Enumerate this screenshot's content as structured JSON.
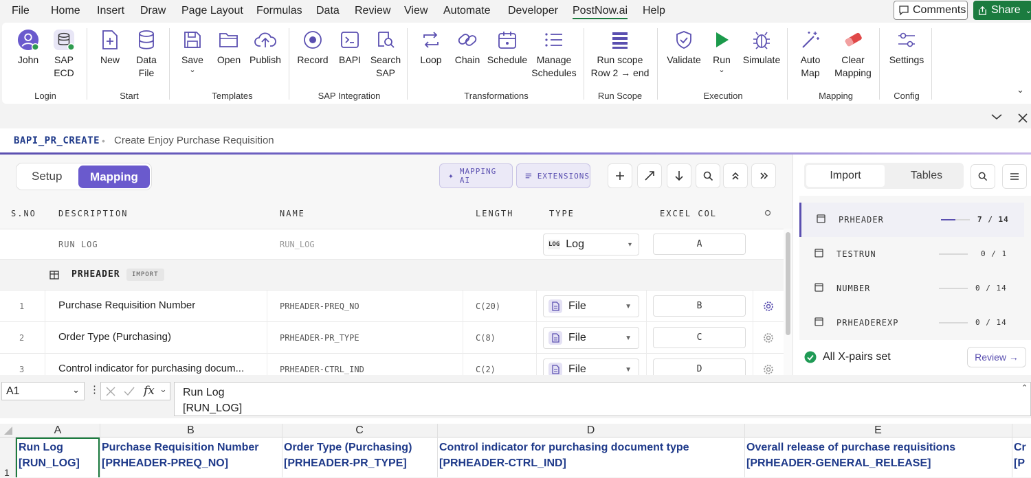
{
  "menu": {
    "items": [
      "File",
      "Home",
      "Insert",
      "Draw",
      "Page Layout",
      "Formulas",
      "Data",
      "Review",
      "View",
      "Automate",
      "Developer",
      "PostNow.ai",
      "Help"
    ],
    "active": "PostNow.ai",
    "comments_label": "Comments",
    "share_label": "Share"
  },
  "ribbon": {
    "buttons": {
      "john": "John",
      "sap_ecd_1": "SAP",
      "sap_ecd_2": "ECD",
      "new": "New",
      "data_file_1": "Data",
      "data_file_2": "File",
      "save": "Save",
      "open": "Open",
      "publish": "Publish",
      "record": "Record",
      "bapi": "BAPI",
      "search_sap_1": "Search",
      "search_sap_2": "SAP",
      "loop": "Loop",
      "chain": "Chain",
      "schedule": "Schedule",
      "manage_1": "Manage",
      "manage_2": "Schedules",
      "run_scope_1": "Run scope",
      "run_scope_2": "Row 2 → end",
      "validate": "Validate",
      "run": "Run",
      "simulate": "Simulate",
      "auto_map_1": "Auto",
      "auto_map_2": "Map",
      "clear_map_1": "Clear",
      "clear_map_2": "Mapping",
      "settings": "Settings"
    },
    "groups": {
      "login": "Login",
      "start": "Start",
      "templates": "Templates",
      "sap_integration": "SAP Integration",
      "transformations": "Transformations",
      "run_scope": "Run Scope",
      "execution": "Execution",
      "mapping": "Mapping",
      "config": "Config"
    },
    "accent_color": "#5a4fb0"
  },
  "pane": {
    "bapi_code": "BAPI_PR_CREATE",
    "separator": "•",
    "bapi_description": "Create Enjoy Purchase Requisition"
  },
  "mapping": {
    "tab_setup": "Setup",
    "tab_mapping": "Mapping",
    "mapping_ai_label": "MAPPING AI",
    "extensions_label": "EXTENSIONS",
    "columns": {
      "sno": "S.NO",
      "description": "DESCRIPTION",
      "name": "NAME",
      "length": "LENGTH",
      "type": "TYPE",
      "excel_col": "EXCEL COL"
    },
    "runlog_row": {
      "description": "RUN LOG",
      "name": "RUN_LOG",
      "type_badge": "LOG",
      "type": "Log",
      "excel_col": "A"
    },
    "section": {
      "name": "PRHEADER",
      "badge": "IMPORT"
    },
    "rows": [
      {
        "sno": "1",
        "description": "Purchase Requisition Number",
        "name": "PRHEADER-PREQ_NO",
        "length": "C(20)",
        "type": "File",
        "excel_col": "B"
      },
      {
        "sno": "2",
        "description": "Order Type (Purchasing)",
        "name": "PRHEADER-PR_TYPE",
        "length": "C(8)",
        "type": "File",
        "excel_col": "C"
      },
      {
        "sno": "3",
        "description": "Control indicator for purchasing docum...",
        "name": "PRHEADER-CTRL_IND",
        "length": "C(2)",
        "type": "File",
        "excel_col": "D"
      }
    ]
  },
  "right_panel": {
    "tab_import": "Import",
    "tab_tables": "Tables",
    "tables": [
      {
        "name": "PRHEADER",
        "count": "7 / 14",
        "progress": 0.5,
        "selected": true
      },
      {
        "name": "TESTRUN",
        "count": "0 / 1",
        "progress": 0,
        "selected": false
      },
      {
        "name": "NUMBER",
        "count": "0 / 14",
        "progress": 0,
        "selected": false
      },
      {
        "name": "PRHEADEREXP",
        "count": "0 / 14",
        "progress": 0,
        "selected": false
      }
    ],
    "status_text": "All X-pairs set",
    "review_label": "Review →"
  },
  "formula_bar": {
    "cell_ref": "A1",
    "fx": "fx",
    "line1": "Run Log",
    "line2": "[RUN_LOG]"
  },
  "grid": {
    "col_letters": [
      "A",
      "B",
      "C",
      "D",
      "E"
    ],
    "row_number": "1",
    "cells": [
      {
        "line1": "Run Log",
        "line2": "[RUN_LOG]"
      },
      {
        "line1": "Purchase Requisition Number",
        "line2": "[PRHEADER-PREQ_NO]"
      },
      {
        "line1": "Order Type (Purchasing)",
        "line2": "[PRHEADER-PR_TYPE]"
      },
      {
        "line1": "Control indicator for purchasing document type",
        "line2": "[PRHEADER-CTRL_IND]"
      },
      {
        "line1": "Overall release of purchase requisitions",
        "line2": "[PRHEADER-GENERAL_RELEASE]"
      },
      {
        "line1": "Cr",
        "line2": "[P"
      }
    ]
  }
}
